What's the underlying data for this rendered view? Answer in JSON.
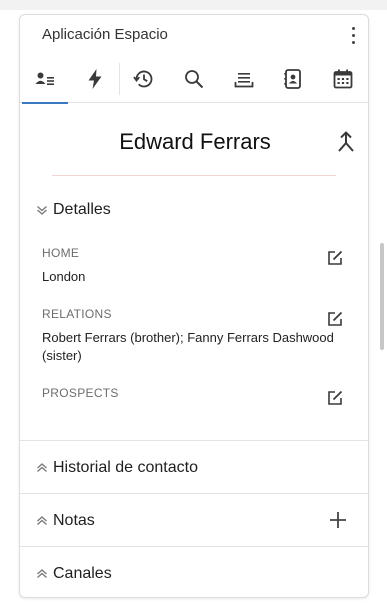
{
  "app": {
    "title": "Aplicación Espacio"
  },
  "toolbar": {
    "items": [
      {
        "name": "contact-card",
        "icon": "contact-card-icon",
        "active": true
      },
      {
        "name": "activity",
        "icon": "lightning-icon",
        "active": false
      },
      {
        "name": "history",
        "icon": "history-icon",
        "active": false
      },
      {
        "name": "search",
        "icon": "search-icon",
        "active": false
      },
      {
        "name": "list",
        "icon": "list-icon",
        "active": false
      },
      {
        "name": "address-book",
        "icon": "address-book-icon",
        "active": false
      },
      {
        "name": "calendar",
        "icon": "calendar-icon",
        "active": false
      }
    ]
  },
  "contact": {
    "name": "Edward Ferrars"
  },
  "details": {
    "title": "Detalles",
    "fields": [
      {
        "label": "HOME",
        "value": "London"
      },
      {
        "label": "RELATIONS",
        "value": "Robert Ferrars (brother); Fanny Ferrars Dashwood (sister)"
      },
      {
        "label": "PROSPECTS",
        "value": ""
      }
    ]
  },
  "sections": {
    "history": {
      "title": "Historial de contacto"
    },
    "notes": {
      "title": "Notas"
    },
    "channels": {
      "title": "Canales"
    }
  },
  "colors": {
    "accent": "#3b78c2",
    "icon": "#3a3a3a"
  }
}
